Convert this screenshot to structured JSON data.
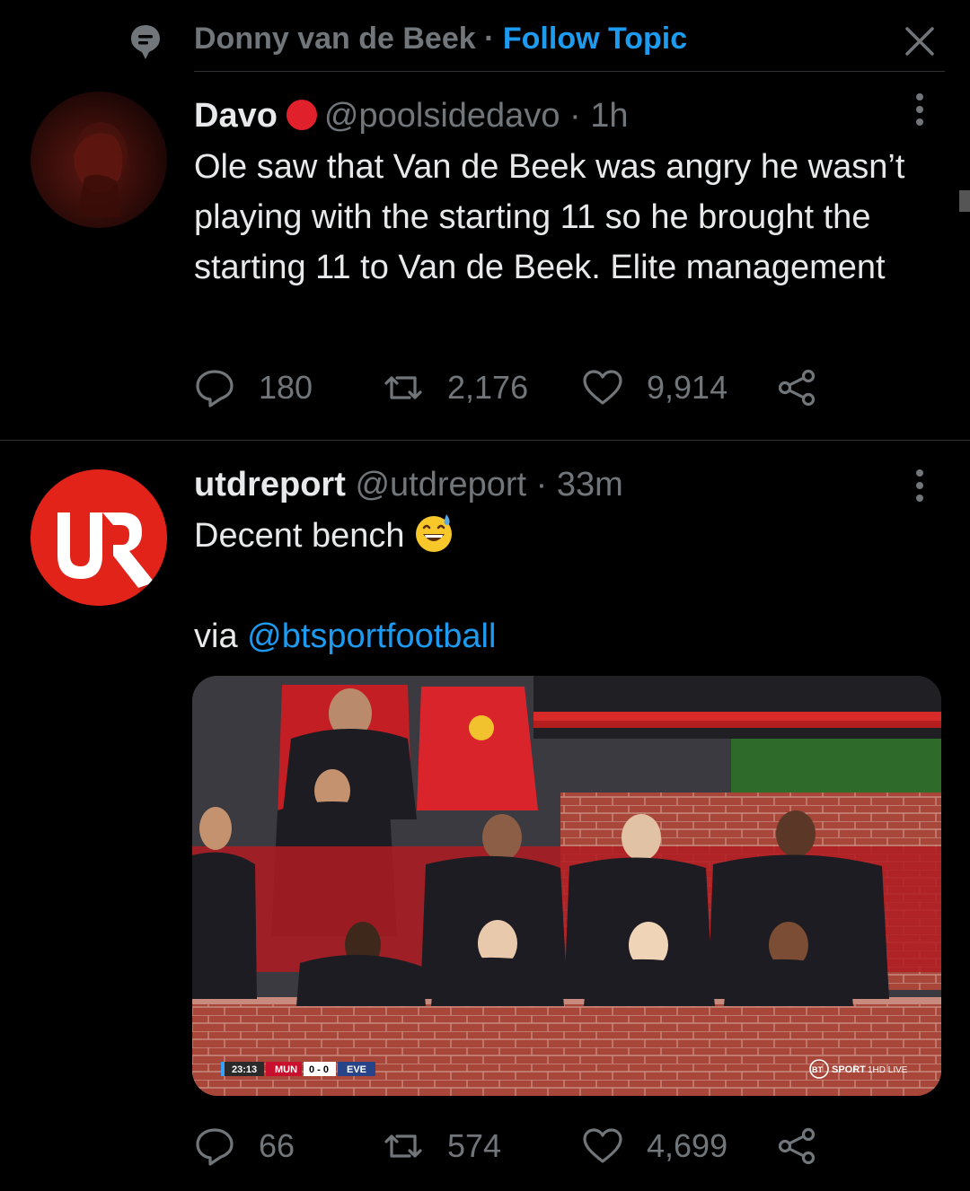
{
  "topic": {
    "name": "Donny van de Beek",
    "separator": "·",
    "follow_label": "Follow Topic"
  },
  "tweets": [
    {
      "name": "Davo",
      "handle": "@poolsidedavo",
      "sep": "·",
      "time": "1h",
      "text": "Ole saw that Van de Beek was angry he wasn’t playing with the starting 11 so he brought the starting 11 to Van de Beek. Elite management",
      "replies": "180",
      "retweets": "2,176",
      "likes": "9,914"
    },
    {
      "name": "utdreport",
      "handle": "@utdreport",
      "sep": "·",
      "time": "33m",
      "text": "Decent bench",
      "via": "via",
      "mention": "@btsportfootball",
      "replies": "66",
      "retweets": "574",
      "likes": "4,699",
      "media": {
        "scoreboard": {
          "clock": "23:13",
          "home": "MUN",
          "score": "0 - 0",
          "away": "EVE"
        },
        "broadcaster": "SPORT",
        "broadcaster_badge": "BT",
        "feed": "1HD LIVE"
      }
    }
  ],
  "colors": {
    "accent": "#1d9bf0",
    "muted": "#71767b",
    "text": "#e7e9ea",
    "divider": "#2f3336",
    "verified_badge": "#e0202a",
    "utdreport_red": "#e2231a"
  },
  "icons": {
    "topic": "topic-icon",
    "close": "close-icon",
    "more": "more-icon",
    "reply": "reply-icon",
    "retweet": "retweet-icon",
    "like": "like-icon",
    "share": "share-icon"
  }
}
